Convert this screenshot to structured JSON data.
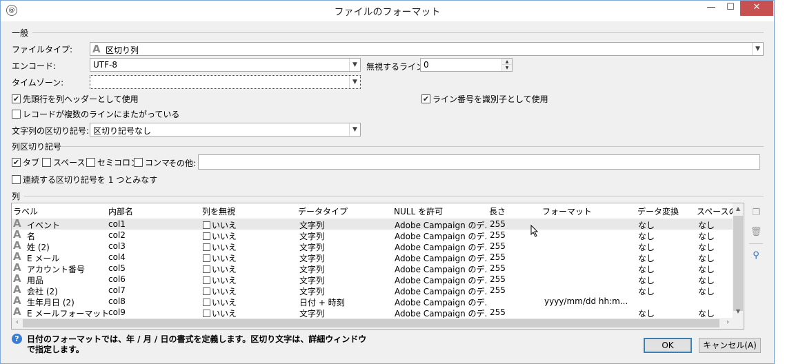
{
  "window": {
    "title": "ファイルのフォーマット",
    "minimize": "—",
    "maximize": "☐",
    "close": "✕"
  },
  "general": {
    "section": "一般",
    "file_type_label": "ファイルタイプ:",
    "file_type_value": "区切り列",
    "encoding_label": "エンコード:",
    "encoding_value": "UTF-8",
    "ignore_lines_label": "無視するライン:",
    "ignore_lines_value": "0",
    "timezone_label": "タイムゾーン:",
    "timezone_value": "",
    "first_row_header": "先頭行を列ヘッダーとして使用",
    "first_row_header_checked": true,
    "line_number_id": "ライン番号を識別子として使用",
    "line_number_id_checked": true,
    "multiline_records": "レコードが複数のラインにまたがっている",
    "multiline_records_checked": false,
    "string_delim_label": "文字列の区切り記号:",
    "string_delim_value": "区切り記号なし"
  },
  "column_separator": {
    "section": "列区切り記号",
    "tab": "タブ",
    "tab_checked": true,
    "space": "スペース",
    "semicolon": "セミコロン",
    "comma": "コンマ",
    "other_label": "その他:",
    "other_value": "",
    "consecutive": "連続する区切り記号を 1 つとみなす"
  },
  "columns": {
    "section": "列",
    "headers": [
      "ラベル",
      "内部名",
      "列を無視",
      "データタイプ",
      "NULL を許可",
      "長さ",
      "フォーマット",
      "データ変換",
      "スペースの処"
    ],
    "rows": [
      {
        "label": "イベント",
        "name": "col1",
        "ignore": "いいえ",
        "type": "文字列",
        "null": "Adobe Campaign のデ...",
        "length": "255",
        "format": "",
        "transform": "なし",
        "space": "なし"
      },
      {
        "label": "名",
        "name": "col2",
        "ignore": "いいえ",
        "type": "文字列",
        "null": "Adobe Campaign のデ...",
        "length": "255",
        "format": "",
        "transform": "なし",
        "space": "なし"
      },
      {
        "label": "姓 (2)",
        "name": "col3",
        "ignore": "いいえ",
        "type": "文字列",
        "null": "Adobe Campaign のデ...",
        "length": "255",
        "format": "",
        "transform": "なし",
        "space": "なし"
      },
      {
        "label": "E メール",
        "name": "col4",
        "ignore": "いいえ",
        "type": "文字列",
        "null": "Adobe Campaign のデ...",
        "length": "255",
        "format": "",
        "transform": "なし",
        "space": "なし"
      },
      {
        "label": "アカウント番号",
        "name": "col5",
        "ignore": "いいえ",
        "type": "文字列",
        "null": "Adobe Campaign のデ...",
        "length": "255",
        "format": "",
        "transform": "なし",
        "space": "なし"
      },
      {
        "label": "用品",
        "name": "col6",
        "ignore": "いいえ",
        "type": "文字列",
        "null": "Adobe Campaign のデ...",
        "length": "255",
        "format": "",
        "transform": "なし",
        "space": "なし"
      },
      {
        "label": "会社 (2)",
        "name": "col7",
        "ignore": "いいえ",
        "type": "文字列",
        "null": "Adobe Campaign のデ...",
        "length": "255",
        "format": "",
        "transform": "なし",
        "space": "なし"
      },
      {
        "label": "生年月日 (2)",
        "name": "col8",
        "ignore": "いいえ",
        "type": "日付 + 時刻",
        "null": "Adobe Campaign のデ...",
        "length": "",
        "format": "yyyy/mm/dd hh:m...",
        "transform": "",
        "space": ""
      },
      {
        "label": "E メールフォーマット",
        "name": "col9",
        "ignore": "いいえ",
        "type": "文字列",
        "null": "Adobe Campaign のデ...",
        "length": "255",
        "format": "",
        "transform": "なし",
        "space": "なし"
      }
    ]
  },
  "footer": {
    "help_text": "日付のフォーマットでは、年 / 月 / 日の書式を定義します。区切り文字は、詳細ウィンドウで指定します。",
    "ok": "OK",
    "cancel": "キャンセル(A)"
  },
  "icons": {
    "app": "app-logo-icon",
    "text_type": "A",
    "help": "?",
    "checkmark": "✔"
  }
}
